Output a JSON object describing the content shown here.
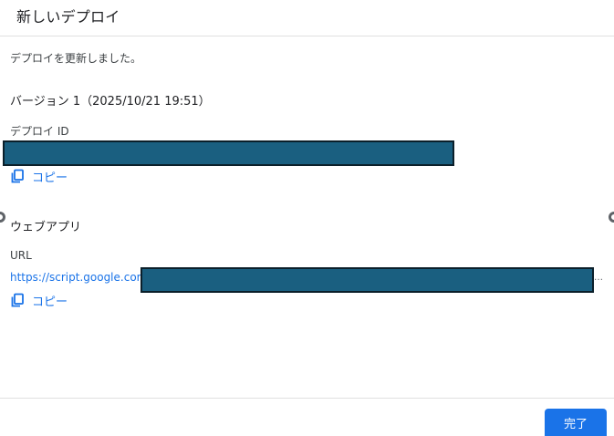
{
  "dialog": {
    "title": "新しいデプロイ",
    "message": "デプロイを更新しました。",
    "version": "バージョン 1（2025/10/21 19:51）",
    "deploy_id": {
      "label": "デプロイ ID",
      "copy_label": "コピー"
    },
    "webapp": {
      "section_title": "ウェブアプリ",
      "url_label": "URL",
      "url_prefix": "https://script.google.com/",
      "ellipsis": "…",
      "copy_label": "コピー"
    },
    "footer": {
      "done_label": "完了"
    }
  },
  "colors": {
    "accent": "#1a73e8",
    "redaction": "#1a5f80"
  },
  "icons": {
    "copy": "copy-icon"
  }
}
